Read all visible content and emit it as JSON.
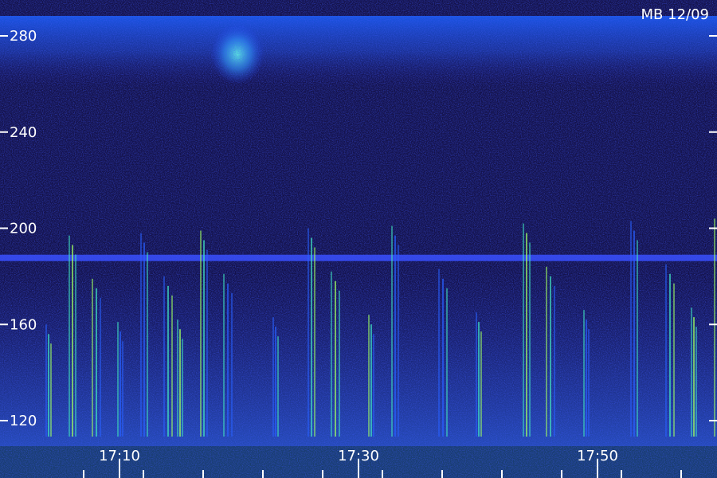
{
  "chart_data": {
    "type": "heatmap",
    "title": "MB 12/09",
    "y_ticks": [
      120,
      160,
      200,
      240,
      280
    ],
    "x_ticks": [
      "17:10",
      "17:30",
      "17:50"
    ],
    "x_tick_positions_min": [
      10,
      30,
      50
    ],
    "x_minor_ticks_min": [
      7,
      12,
      17,
      22,
      27,
      32,
      37,
      42,
      47,
      52,
      57
    ],
    "ylim": [
      112,
      293
    ],
    "xlim_min": [
      3,
      62
    ],
    "vertical_bursts_min": [
      4,
      6,
      8,
      10,
      12,
      14,
      15,
      17,
      19,
      23,
      26,
      28,
      31,
      33,
      37,
      40,
      44,
      46,
      49,
      53,
      56,
      58,
      60
    ],
    "horizontal_band_y": 188,
    "grid": false,
    "colors": {
      "background": "#14124a",
      "low": "#1a1aa0",
      "mid": "#2860ff",
      "high": "#40e0c0",
      "peak": "#a0ff60",
      "text": "#ffffff"
    }
  }
}
